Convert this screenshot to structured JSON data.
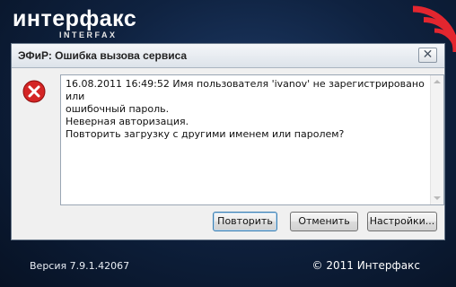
{
  "brand": {
    "name": "интерфакс",
    "sub": "INTERFAX"
  },
  "dialog": {
    "title": "ЭФиР: Ошибка вызова сервиса",
    "close_glyph": "✕",
    "message": "16.08.2011 16:49:52 Имя пользователя 'ivanov' не зарегистрировано или\nошибочный пароль.\nНеверная авторизация.\nПовторить загрузку с другими именем или паролем?",
    "buttons": {
      "retry": "Повторить",
      "cancel": "Отменить",
      "settings": "Настройки..."
    }
  },
  "footer": {
    "version": "Версия 7.9.1.42067",
    "copyright": "© 2011 Интерфакс"
  },
  "colors": {
    "error_red": "#d42525",
    "accent_red": "#e3262f",
    "background": "#0f2240"
  },
  "icons": {
    "error": "error-icon",
    "close": "close-icon",
    "logo_waves": "signal-waves-icon"
  }
}
